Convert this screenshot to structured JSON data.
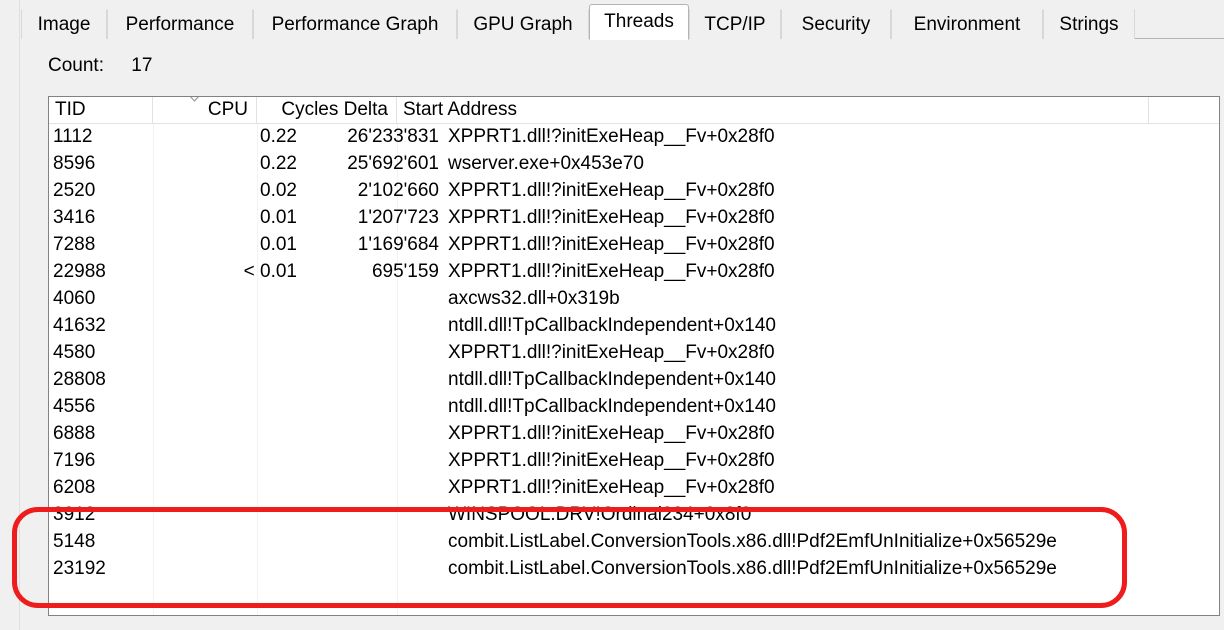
{
  "window": {
    "accent_red": "#ee1c1c",
    "border_color": "#828282"
  },
  "tabs": {
    "items": [
      {
        "label": "Image",
        "selected": false
      },
      {
        "label": "Performance",
        "selected": false
      },
      {
        "label": "Performance Graph",
        "selected": false
      },
      {
        "label": "GPU Graph",
        "selected": false
      },
      {
        "label": "Threads",
        "selected": true
      },
      {
        "label": "TCP/IP",
        "selected": false
      },
      {
        "label": "Security",
        "selected": false
      },
      {
        "label": "Environment",
        "selected": false
      },
      {
        "label": "Strings",
        "selected": false
      }
    ]
  },
  "summary": {
    "count_label": "Count:",
    "count_value": "17"
  },
  "table": {
    "columns": [
      {
        "key": "tid",
        "label": "TID",
        "sorted": false
      },
      {
        "key": "cpu",
        "label": "CPU",
        "sorted": true,
        "sort_direction": "descending",
        "sort_icon": "chevron-down-icon"
      },
      {
        "key": "cycles",
        "label": "Cycles Delta",
        "sorted": false
      },
      {
        "key": "addr",
        "label": "Start Address",
        "sorted": false
      }
    ],
    "rows": [
      {
        "tid": "1112",
        "cpu": "0.22",
        "cycles": "26'233'831",
        "addr": "XPPRT1.dll!?initExeHeap__Fv+0x28f0"
      },
      {
        "tid": "8596",
        "cpu": "0.22",
        "cycles": "25'692'601",
        "addr": "wserver.exe+0x453e70"
      },
      {
        "tid": "2520",
        "cpu": "0.02",
        "cycles": "2'102'660",
        "addr": "XPPRT1.dll!?initExeHeap__Fv+0x28f0"
      },
      {
        "tid": "3416",
        "cpu": "0.01",
        "cycles": "1'207'723",
        "addr": "XPPRT1.dll!?initExeHeap__Fv+0x28f0"
      },
      {
        "tid": "7288",
        "cpu": "0.01",
        "cycles": "1'169'684",
        "addr": "XPPRT1.dll!?initExeHeap__Fv+0x28f0"
      },
      {
        "tid": "22988",
        "cpu": "< 0.01",
        "cycles": "695'159",
        "addr": "XPPRT1.dll!?initExeHeap__Fv+0x28f0"
      },
      {
        "tid": "4060",
        "cpu": "",
        "cycles": "",
        "addr": "axcws32.dll+0x319b"
      },
      {
        "tid": "41632",
        "cpu": "",
        "cycles": "",
        "addr": "ntdll.dll!TpCallbackIndependent+0x140"
      },
      {
        "tid": "4580",
        "cpu": "",
        "cycles": "",
        "addr": "XPPRT1.dll!?initExeHeap__Fv+0x28f0"
      },
      {
        "tid": "28808",
        "cpu": "",
        "cycles": "",
        "addr": "ntdll.dll!TpCallbackIndependent+0x140"
      },
      {
        "tid": "4556",
        "cpu": "",
        "cycles": "",
        "addr": "ntdll.dll!TpCallbackIndependent+0x140"
      },
      {
        "tid": "6888",
        "cpu": "",
        "cycles": "",
        "addr": "XPPRT1.dll!?initExeHeap__Fv+0x28f0"
      },
      {
        "tid": "7196",
        "cpu": "",
        "cycles": "",
        "addr": "XPPRT1.dll!?initExeHeap__Fv+0x28f0"
      },
      {
        "tid": "6208",
        "cpu": "",
        "cycles": "",
        "addr": "XPPRT1.dll!?initExeHeap__Fv+0x28f0"
      },
      {
        "tid": "3912",
        "cpu": "",
        "cycles": "",
        "addr": "WINSPOOL.DRV!Ordinal234+0x8f0"
      },
      {
        "tid": "5148",
        "cpu": "",
        "cycles": "",
        "addr": "combit.ListLabel.ConversionTools.x86.dll!Pdf2EmfUnInitialize+0x56529e"
      },
      {
        "tid": "23192",
        "cpu": "",
        "cycles": "",
        "addr": "combit.ListLabel.ConversionTools.x86.dll!Pdf2EmfUnInitialize+0x56529e"
      }
    ]
  },
  "annotation": {
    "shape": "rounded-rectangle",
    "color": "#ee1c1c",
    "highlighted_row_tids": [
      "3912",
      "5148",
      "23192"
    ]
  }
}
